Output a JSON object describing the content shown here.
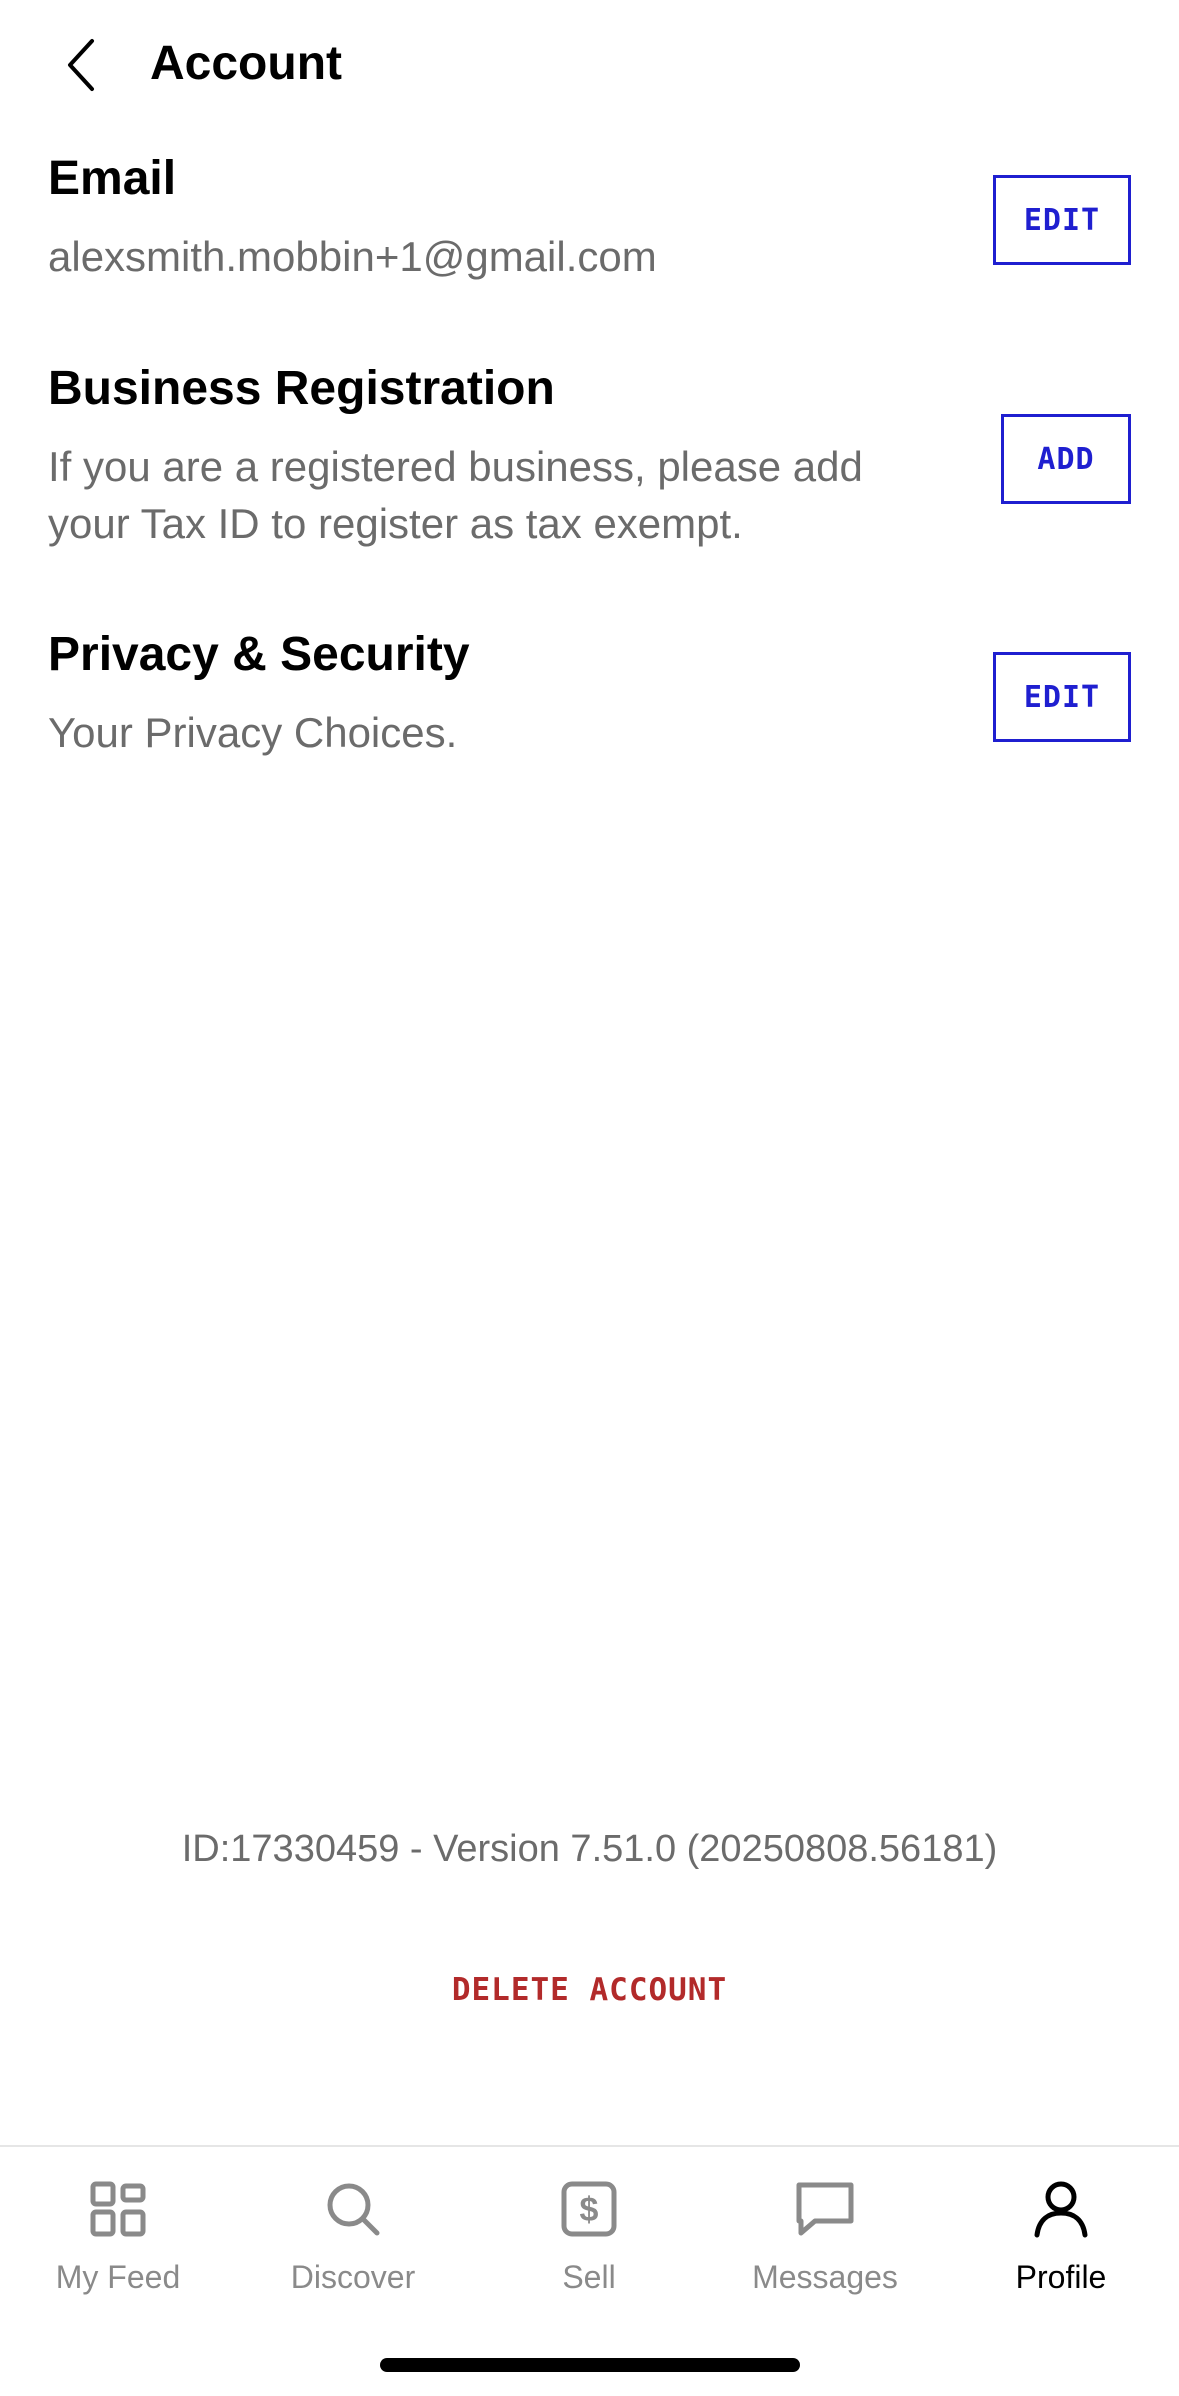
{
  "header": {
    "title": "Account"
  },
  "sections": [
    {
      "title": "Email",
      "description": "alexsmith.mobbin+1@gmail.com",
      "action_label": "EDIT"
    },
    {
      "title": "Business Registration",
      "description": "If you are a registered business, please add your Tax ID to register as tax exempt.",
      "action_label": "ADD"
    },
    {
      "title": "Privacy & Security",
      "description": "Your Privacy Choices.",
      "action_label": "EDIT"
    }
  ],
  "footer": {
    "version_text": "ID:17330459 - Version 7.51.0 (20250808.56181)",
    "delete_label": "DELETE ACCOUNT"
  },
  "tabbar": {
    "items": [
      {
        "label": "My Feed",
        "icon": "grid-icon",
        "active": false
      },
      {
        "label": "Discover",
        "icon": "search-icon",
        "active": false
      },
      {
        "label": "Sell",
        "icon": "dollar-tag-icon",
        "active": false
      },
      {
        "label": "Messages",
        "icon": "chat-bubble-icon",
        "active": false
      },
      {
        "label": "Profile",
        "icon": "person-icon",
        "active": true
      }
    ]
  },
  "colors": {
    "accent": "#1f1fd0",
    "danger": "#b22a2a",
    "muted_text": "#6b6b6b",
    "inactive_tab": "#8a8a8a"
  }
}
